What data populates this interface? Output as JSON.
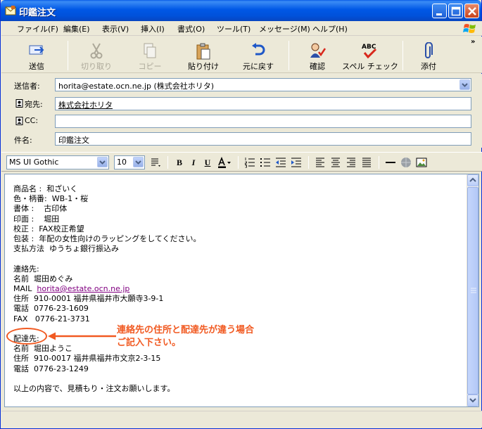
{
  "window": {
    "title": "印鑑注文"
  },
  "menu": [
    "ファイル(F)",
    "編集(E)",
    "表示(V)",
    "挿入(I)",
    "書式(O)",
    "ツール(T)",
    "メッセージ(M)",
    "ヘルプ(H)"
  ],
  "toolbar": {
    "send": "送信",
    "cut": "切り取り",
    "copy": "コピー",
    "paste": "貼り付け",
    "undo": "元に戻す",
    "check": "確認",
    "spell": "スペル チェック",
    "spell_icon_text": "ABC",
    "attach": "添付"
  },
  "headers": {
    "from_label": "送信者:",
    "from_value": "horita@estate.ocn.ne.jp     (株式会社ホリタ)",
    "to_label": "宛先:",
    "to_value": "株式会社ホリタ",
    "cc_label": "CC:",
    "cc_value": "",
    "subject_label": "件名:",
    "subject_value": "印鑑注文"
  },
  "format": {
    "font": "MS UI Gothic",
    "size": "10"
  },
  "message": {
    "lines_top": "商品名 :  和ざいく\n色・柄番:  WB-1・桜\n書体 :    古印体\n印面 :    堀田\n校正 :  FAX校正希望\n包装 :  年配の女性向けのラッピングをしてください。\n支払方法  ゆうちょ銀行振込み\n\n連絡先:\n名前  堀田めぐみ",
    "mail_label": "MAIL  ",
    "mail_value": "horita@estate.ocn.ne.jp",
    "lines_mid": "住所  910-0001 福井県福井市大願寺3-9-1\n電話  0776-23-1609\nFAX   0776-21-3731\n\n配達先:\n名前  堀田ようこ\n住所  910-0017 福井県福井市文京2-3-15\n電話  0776-23-1249\n\n以上の内容で、見積もり・注文お願いします。"
  },
  "annotation": {
    "text": "連絡先の住所と配達先が違う場合\nご記入下さい。",
    "color": "#f15a22"
  }
}
